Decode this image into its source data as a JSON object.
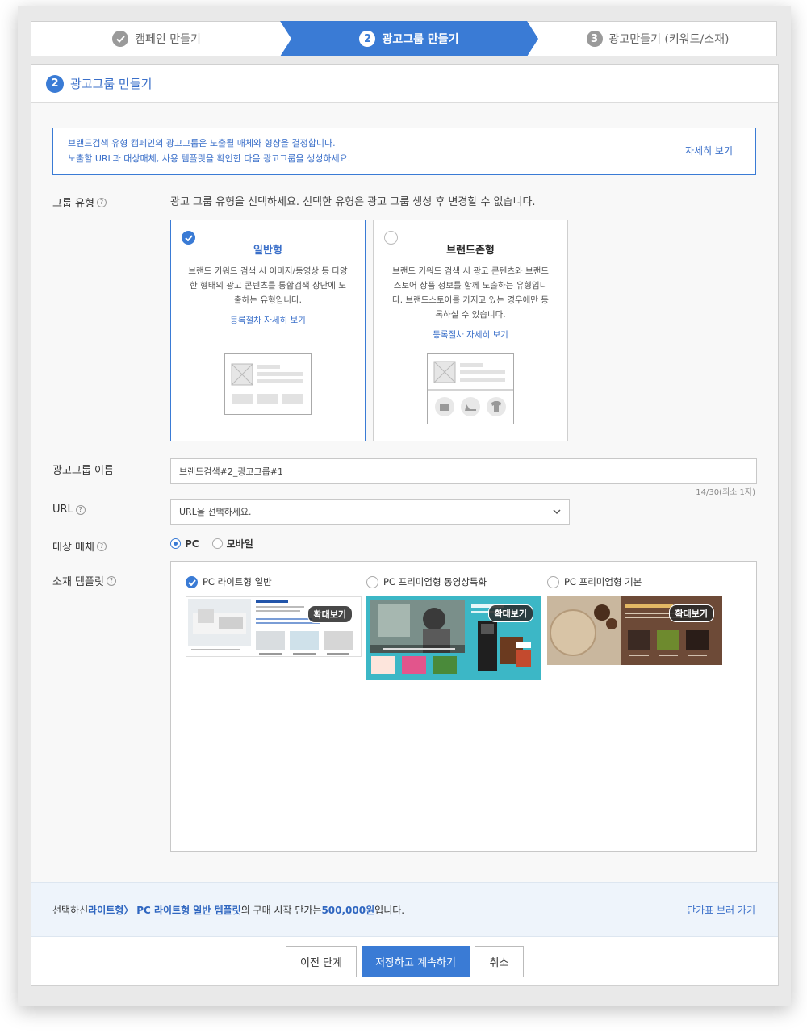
{
  "steps": [
    {
      "num": "✓",
      "label": "캠페인 만들기"
    },
    {
      "num": "2",
      "label": "광고그룹 만들기"
    },
    {
      "num": "3",
      "label": "광고만들기 (키워드/소재)"
    }
  ],
  "panel": {
    "num": "2",
    "title": "광고그룹 만들기"
  },
  "notice": {
    "line1": "브랜드검색 유형 캠페인의 광고그룹은 노출될 매체와 형상을 결정합니다.",
    "line2": "노출할 URL과 대상매체, 사용 템플릿을 확인한 다음 광고그룹을 생성하세요.",
    "more": "자세히 보기"
  },
  "group_type": {
    "label": "그룹 유형",
    "hint": "광고 그룹 유형을 선택하세요. 선택한 유형은 광고 그룹 생성 후 변경할 수 없습니다.",
    "cards": [
      {
        "title": "일반형",
        "desc": "브랜드 키워드 검색 시 이미지/동영상 등 다양한 형태의 광고 콘텐츠를 통합검색 상단에 노출하는 유형입니다.",
        "link": "등록절차 자세히 보기"
      },
      {
        "title": "브랜드존형",
        "desc": "브랜드 키워드 검색 시 광고 콘텐츠와 브랜드스토어 상품 정보를 함께 노출하는 유형입니다. 브랜드스토어를 가지고 있는 경우에만 등록하실 수 있습니다.",
        "link": "등록절차 자세히 보기"
      }
    ]
  },
  "name_field": {
    "label": "광고그룹 이름",
    "value": "브랜드검색#2_광고그룹#1",
    "counter": "14/30(최소 1자)"
  },
  "url_field": {
    "label": "URL",
    "placeholder": "URL을 선택하세요."
  },
  "media": {
    "label": "대상 매체",
    "options": [
      "PC",
      "모바일"
    ]
  },
  "template": {
    "label": "소재 템플릿",
    "items": [
      {
        "label": "PC 라이트형 일반",
        "zoom": "확대보기"
      },
      {
        "label": "PC 프리미엄형 동영상특화",
        "zoom": "확대보기"
      },
      {
        "label": "PC 프리미엄형 기본",
        "zoom": "확대보기"
      }
    ]
  },
  "footer": {
    "prefix": "선택하신 ",
    "type": "라이트형",
    "sep": " 〉",
    "template": "PC 라이트형 일반 템플릿",
    "mid": "의 구매 시작 단가는 ",
    "price": "500,000원",
    "suffix": " 입니다.",
    "link": "단가표 보러 가기"
  },
  "buttons": {
    "prev": "이전 단계",
    "save": "저장하고 계속하기",
    "cancel": "취소"
  },
  "colors": {
    "accent": "#3a7bd5"
  }
}
